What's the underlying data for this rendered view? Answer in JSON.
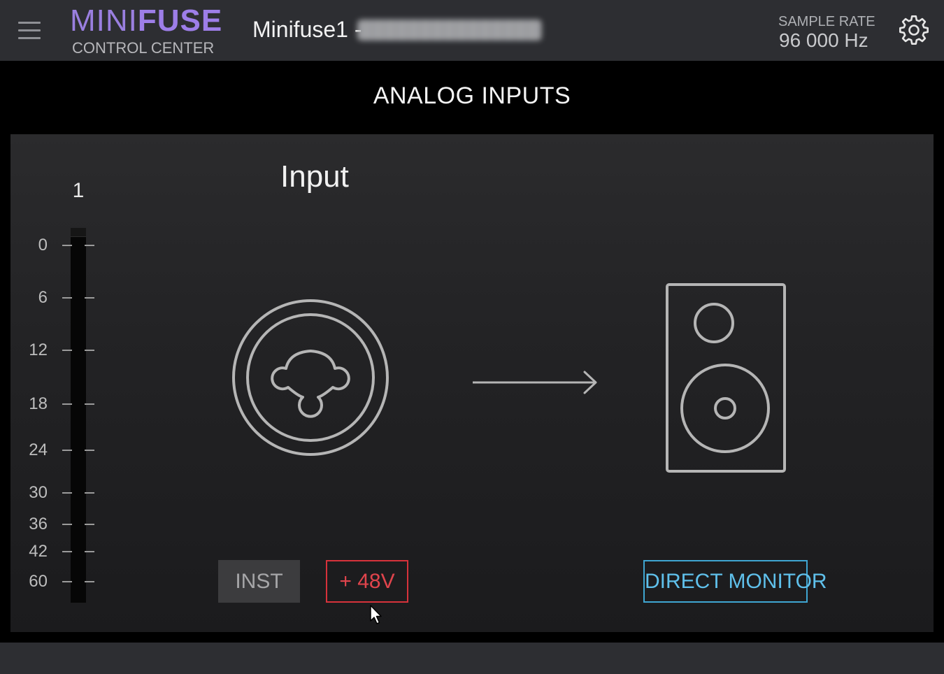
{
  "header": {
    "logo_top_light": "MINI",
    "logo_top_bold": "FUSE",
    "logo_subtitle": "CONTROL CENTER",
    "device_name": "Minifuse1 -",
    "sample_rate_label": "SAMPLE RATE",
    "sample_rate_value": "96 000 Hz",
    "menu_icon": "hamburger-menu-icon",
    "settings_icon": "gear-icon"
  },
  "section": {
    "title": "ANALOG INPUTS"
  },
  "channel": {
    "number": "1",
    "title": "Input",
    "meter_scale": [
      "0",
      "6",
      "12",
      "18",
      "24",
      "30",
      "36",
      "42",
      "60"
    ],
    "meter_level": 0
  },
  "buttons": {
    "inst_label": "INST",
    "phantom_label": "+ 48V",
    "direct_monitor_label": "DIRECT MONITOR"
  },
  "icons": {
    "input_connector": "xlr-combo-jack-icon",
    "routing_arrow": "arrow-right-icon",
    "monitor": "speaker-icon"
  },
  "colors": {
    "header_bg": "#2d2e32",
    "logo_accent": "#9d7ee8",
    "phantom_red": "#e0444c",
    "direct_monitor_blue": "#5fc0eb",
    "inst_bg": "#3c3c3e"
  }
}
